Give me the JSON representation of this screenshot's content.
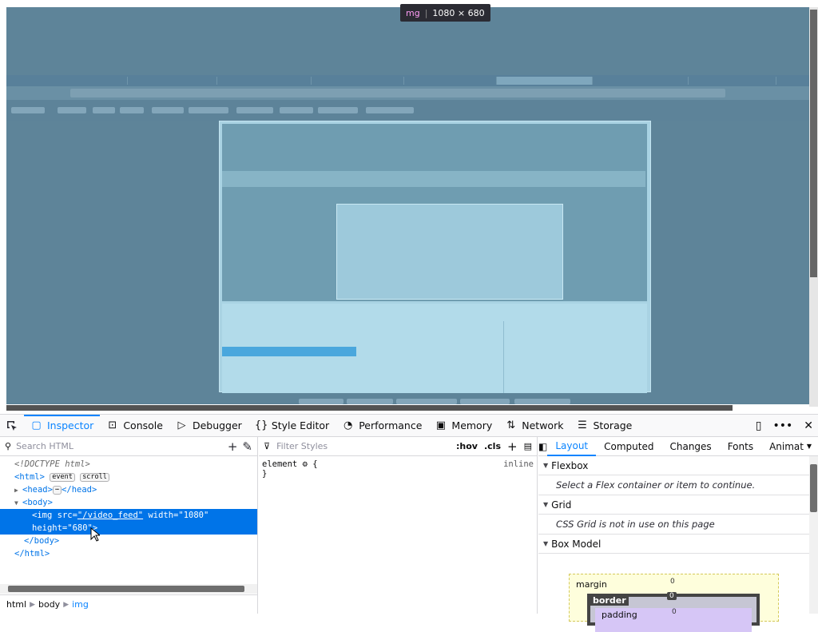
{
  "size_tooltip": {
    "tag": "mg",
    "dims": "1080 × 680"
  },
  "toolbar": {
    "tabs": [
      {
        "label": "Inspector",
        "icon": "inspector-icon"
      },
      {
        "label": "Console",
        "icon": "console-icon"
      },
      {
        "label": "Debugger",
        "icon": "debugger-icon"
      },
      {
        "label": "Style Editor",
        "icon": "style-editor-icon"
      },
      {
        "label": "Performance",
        "icon": "performance-icon"
      },
      {
        "label": "Memory",
        "icon": "memory-icon"
      },
      {
        "label": "Network",
        "icon": "network-icon"
      },
      {
        "label": "Storage",
        "icon": "storage-icon"
      }
    ]
  },
  "markup": {
    "search_placeholder": "Search HTML",
    "doctype": "<!DOCTYPE html>",
    "html_open": "<html>",
    "badge_event": "event",
    "badge_scroll": "scroll",
    "head_open": "<head>",
    "head_ellipsis": "⋯",
    "head_close": "</head>",
    "body_open": "<body>",
    "img_tag": "<img",
    "img_src_attr": "src=",
    "img_src_val": "\"/video_feed\"",
    "img_width_attr": "width=",
    "img_width_val": "\"1080\"",
    "img_height_attr": "height=",
    "img_height_val": "\"680\"",
    "img_close": ">",
    "body_close": "</body>",
    "html_close": "</html>"
  },
  "breadcrumbs": [
    "html",
    "body",
    "img"
  ],
  "rules": {
    "filter_placeholder": "Filter Styles",
    "hov": ":hov",
    "cls": ".cls",
    "selector": "element",
    "brace_open": "{",
    "brace_close": "}",
    "source": "inline"
  },
  "layout_panel": {
    "tabs": [
      "Layout",
      "Computed",
      "Changes",
      "Fonts",
      "Animat"
    ],
    "flexbox": {
      "title": "Flexbox",
      "message": "Select a Flex container or item to continue."
    },
    "grid": {
      "title": "Grid",
      "message": "CSS Grid is not in use on this page"
    },
    "boxmodel": {
      "title": "Box Model",
      "margin_label": "margin",
      "border_label": "border",
      "padding_label": "padding",
      "margin_top": "0",
      "border_top": "0",
      "padding_top": "0"
    }
  },
  "colors": {
    "accent": "#0a84ff",
    "selection": "#0074e8",
    "highlight_overlay": "#5e8499"
  }
}
